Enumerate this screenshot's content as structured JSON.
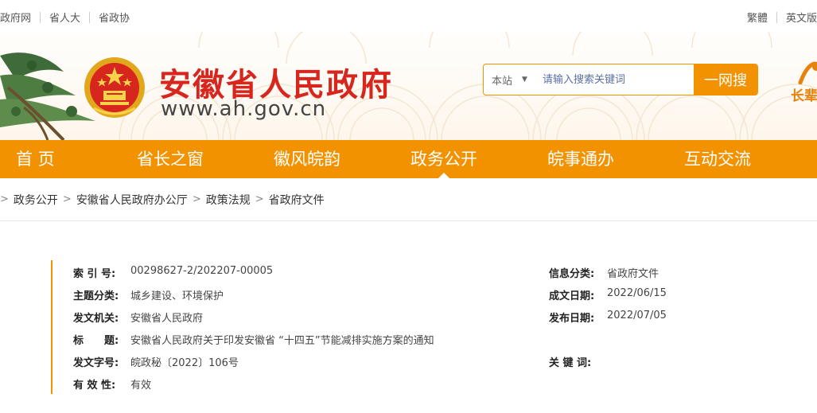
{
  "topbar": {
    "left_links": [
      "政府网",
      "省人大",
      "省政协"
    ],
    "right_links": [
      "繁體",
      "英文版"
    ]
  },
  "header": {
    "title": "安徽省人民政府",
    "url": "www.ah.gov.cn",
    "search": {
      "scope": "本站",
      "placeholder": "请输入搜索关键词",
      "button": "一网搜"
    },
    "gov_label": "长辈"
  },
  "nav": {
    "items": [
      "首 页",
      "省长之窗",
      "徽风皖韵",
      "政务公开",
      "皖事通办",
      "互动交流"
    ],
    "active": "政务公开"
  },
  "breadcrumb": [
    "政务公开",
    "安徽省人民政府办公厅",
    "政策法规",
    "省政府文件"
  ],
  "meta": {
    "index_label": "索 引 号:",
    "index_value": "00298627-2/202207-00005",
    "category_label": "信息分类:",
    "category_value": "省政府文件",
    "topic_label": "主题分类:",
    "topic_value": "城乡建设、环境保护",
    "written_label": "成文日期:",
    "written_value": "2022/06/15",
    "issuer_label": "发文机关:",
    "issuer_value": "安徽省人民政府",
    "published_label": "发布日期:",
    "published_value": "2022/07/05",
    "title_label": "标　　题:",
    "title_value": "安徽省人民政府关于印发安徽省 “十四五”节能减排实施方案的通知",
    "docno_label": "发文字号:",
    "docno_value": "皖政秘〔2022〕106号",
    "keywords_label": "关 键 词:",
    "keywords_value": "",
    "validity_label": "有 效 性:",
    "validity_value": "有效"
  },
  "colors": {
    "accent": "#f39200",
    "title_red": "#d7261e"
  }
}
